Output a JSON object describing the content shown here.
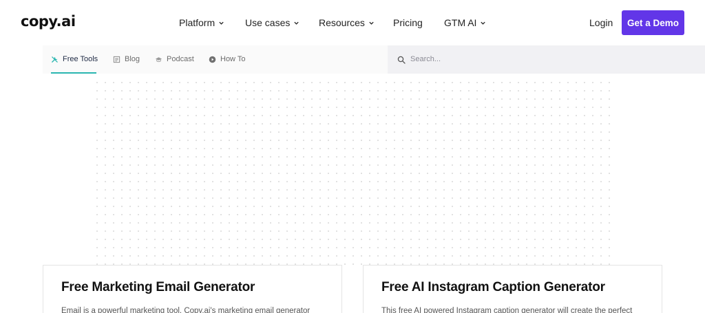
{
  "header": {
    "logo": "copy.ai",
    "nav": [
      {
        "label": "Platform",
        "has_dropdown": true
      },
      {
        "label": "Use cases",
        "has_dropdown": true
      },
      {
        "label": "Resources",
        "has_dropdown": true
      },
      {
        "label": "Pricing",
        "has_dropdown": false
      },
      {
        "label": "GTM AI",
        "has_dropdown": true
      }
    ],
    "login": "Login",
    "cta": "Get a Demo",
    "cta_color": "#6236e8"
  },
  "subnav": {
    "tabs": [
      {
        "label": "Free Tools",
        "icon": "tools-icon",
        "active": true
      },
      {
        "label": "Blog",
        "icon": "blog-icon",
        "active": false
      },
      {
        "label": "Podcast",
        "icon": "podcast-icon",
        "active": false
      },
      {
        "label": "How To",
        "icon": "play-icon",
        "active": false
      }
    ],
    "active_color": "#29b6b0",
    "search": {
      "placeholder": "Search..."
    }
  },
  "cards": [
    {
      "title": "Free Marketing Email Generator",
      "description": "Email is a powerful marketing tool. Copy.ai's marketing email generator"
    },
    {
      "title": "Free AI Instagram Caption Generator",
      "description": "This free AI powered Instagram caption generator will create the perfect"
    }
  ]
}
